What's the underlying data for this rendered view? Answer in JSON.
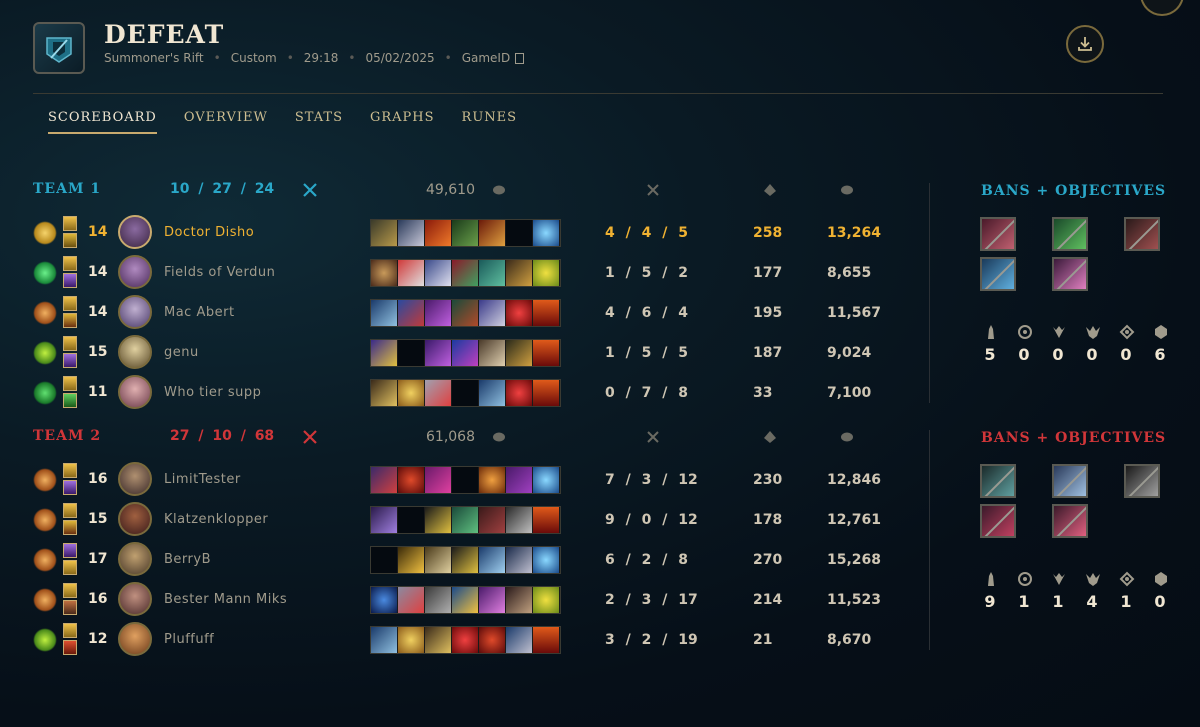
{
  "header": {
    "result": "DEFEAT",
    "map": "Summoner's Rift",
    "mode": "Custom",
    "duration": "29:18",
    "date": "05/02/2025",
    "game_id_label": "GameID"
  },
  "tabs": [
    "SCOREBOARD",
    "OVERVIEW",
    "STATS",
    "GRAPHS",
    "RUNES"
  ],
  "team1": {
    "name": "TEAM 1",
    "kda": "10 / 27 / 24",
    "gold": "49,610",
    "color": "#2aa7c8",
    "players": [
      {
        "level": "14",
        "name": "Doctor Disho",
        "kda": "4 / 4 / 5",
        "cs": "258",
        "gold": "13,264",
        "me": true
      },
      {
        "level": "14",
        "name": "Fields of Verdun",
        "kda": "1 / 5 / 2",
        "cs": "177",
        "gold": "8,655"
      },
      {
        "level": "14",
        "name": "Mac Abert",
        "kda": "4 / 6 / 4",
        "cs": "195",
        "gold": "11,567"
      },
      {
        "level": "15",
        "name": "genu",
        "kda": "1 / 5 / 5",
        "cs": "187",
        "gold": "9,024"
      },
      {
        "level": "11",
        "name": "Who tier supp",
        "kda": "0 / 7 / 8",
        "cs": "33",
        "gold": "7,100"
      }
    ],
    "bans_title": "BANS + OBJECTIVES",
    "objectives": [
      "5",
      "0",
      "0",
      "0",
      "0",
      "6"
    ]
  },
  "team2": {
    "name": "TEAM 2",
    "kda": "27 / 10 / 68",
    "gold": "61,068",
    "color": "#d13639",
    "players": [
      {
        "level": "16",
        "name": "LimitTester",
        "kda": "7 / 3 / 12",
        "cs": "230",
        "gold": "12,846"
      },
      {
        "level": "15",
        "name": "Klatzenklopper",
        "kda": "9 / 0 / 12",
        "cs": "178",
        "gold": "12,761"
      },
      {
        "level": "17",
        "name": "BerryB",
        "kda": "6 / 2 / 8",
        "cs": "270",
        "gold": "15,268"
      },
      {
        "level": "16",
        "name": "Bester Mann Miks",
        "kda": "2 / 3 / 17",
        "cs": "214",
        "gold": "11,523"
      },
      {
        "level": "12",
        "name": "Pluffuff",
        "kda": "3 / 2 / 19",
        "cs": "21",
        "gold": "8,670"
      }
    ],
    "bans_title": "BANS + OBJECTIVES",
    "objectives": [
      "9",
      "1",
      "1",
      "4",
      "1",
      "0"
    ]
  },
  "icons": {
    "download": "download-icon",
    "close": "close-icon",
    "copy": "copy-icon",
    "kda_header": "crossed-swords-icon",
    "cs_header": "minion-icon",
    "gold_header": "gold-coins-icon",
    "objectives": [
      "tower-icon",
      "inhibitor-icon",
      "baron-icon",
      "dragon-icon",
      "rift-herald-icon",
      "void-grub-icon"
    ]
  }
}
